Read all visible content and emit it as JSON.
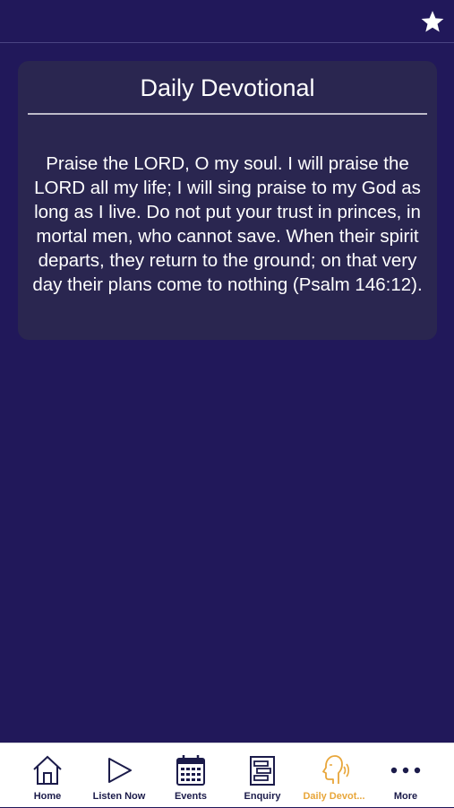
{
  "header": {
    "favorite_icon": "star-icon"
  },
  "devotional": {
    "title": "Daily Devotional",
    "text": "Praise the LORD, O my soul. I will praise the LORD all my life; I will sing praise to my God as long as I live. Do not put your trust in princes, in mortal men, who cannot save. When their spirit departs, they return to the ground; on that very day their plans come to nothing (Psalm 146:12)."
  },
  "tabs": [
    {
      "label": "Home",
      "icon": "home-icon"
    },
    {
      "label": "Listen Now",
      "icon": "play-icon"
    },
    {
      "label": "Events",
      "icon": "calendar-icon"
    },
    {
      "label": "Enquiry",
      "icon": "form-icon"
    },
    {
      "label": "Daily Devot...",
      "icon": "speaking-head-icon",
      "active": true
    },
    {
      "label": "More",
      "icon": "more-dots-icon"
    }
  ],
  "colors": {
    "background": "#21185a",
    "card": "#2a2650",
    "tab_icon": "#1b1b4a",
    "active_tab": "#e8a63a"
  }
}
